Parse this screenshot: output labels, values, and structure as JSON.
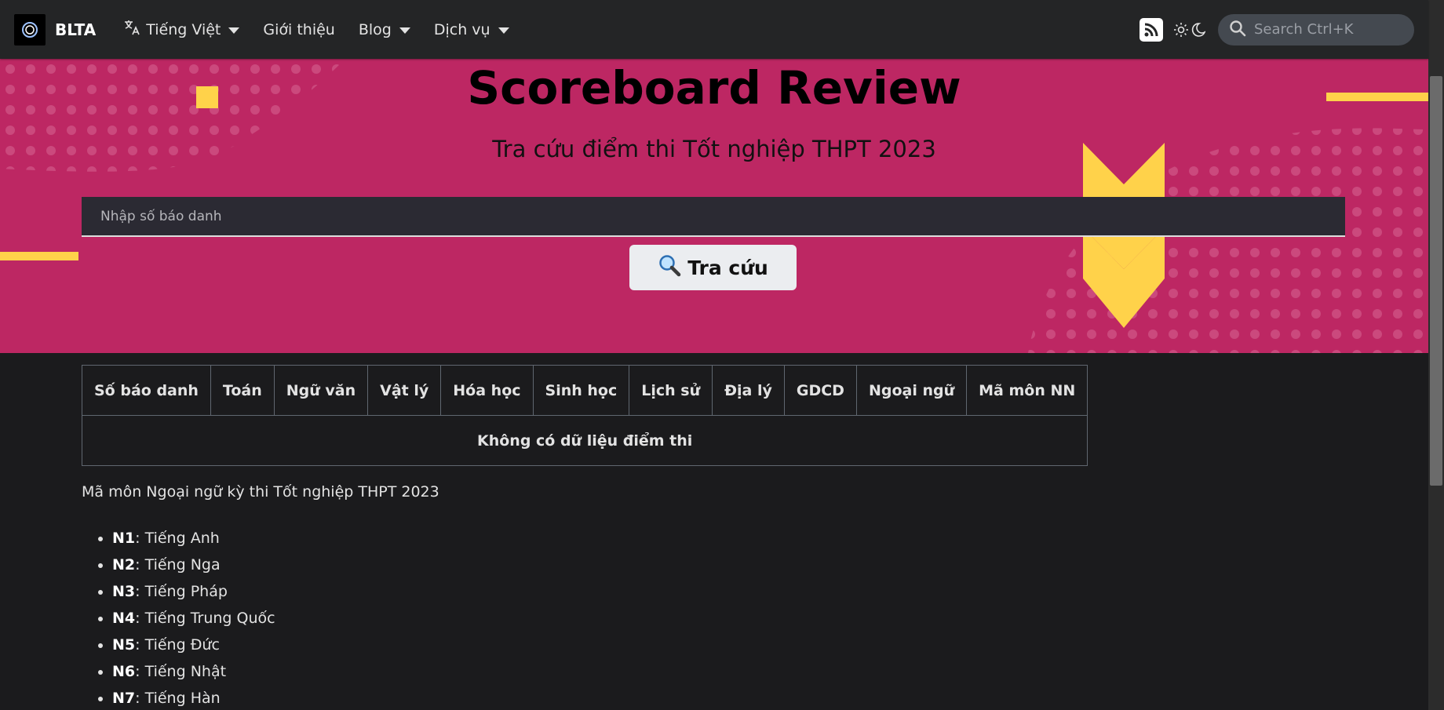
{
  "navbar": {
    "brand": "BLTA",
    "language": "Tiếng Việt",
    "items": [
      {
        "label": "Giới thiệu",
        "dropdown": false
      },
      {
        "label": "Blog",
        "dropdown": true
      },
      {
        "label": "Dịch vụ",
        "dropdown": true
      }
    ],
    "search_placeholder": "Search Ctrl+K"
  },
  "hero": {
    "title": "Scoreboard Review",
    "subtitle": "Tra cứu điểm thi Tốt nghiệp THPT 2023",
    "input_placeholder": "Nhập số báo danh",
    "button_label": "Tra cứu",
    "colors": {
      "background": "#bd2763",
      "accent": "#ffd24a"
    }
  },
  "table": {
    "headers": [
      "Số báo danh",
      "Toán",
      "Ngữ văn",
      "Vật lý",
      "Hóa học",
      "Sinh học",
      "Lịch sử",
      "Địa lý",
      "GDCD",
      "Ngoại ngữ",
      "Mã môn NN"
    ],
    "empty_message": "Không có dữ liệu điểm thi"
  },
  "notes": {
    "intro": "Mã môn Ngoại ngữ kỳ thi Tốt nghiệp THPT 2023",
    "languages": [
      {
        "code": "N1",
        "name": ": Tiếng Anh"
      },
      {
        "code": "N2",
        "name": ": Tiếng Nga"
      },
      {
        "code": "N3",
        "name": ": Tiếng Pháp"
      },
      {
        "code": "N4",
        "name": ": Tiếng Trung Quốc"
      },
      {
        "code": "N5",
        "name": ": Tiếng Đức"
      },
      {
        "code": "N6",
        "name": ": Tiếng Nhật"
      },
      {
        "code": "N7",
        "name": ": Tiếng Hàn"
      }
    ]
  }
}
